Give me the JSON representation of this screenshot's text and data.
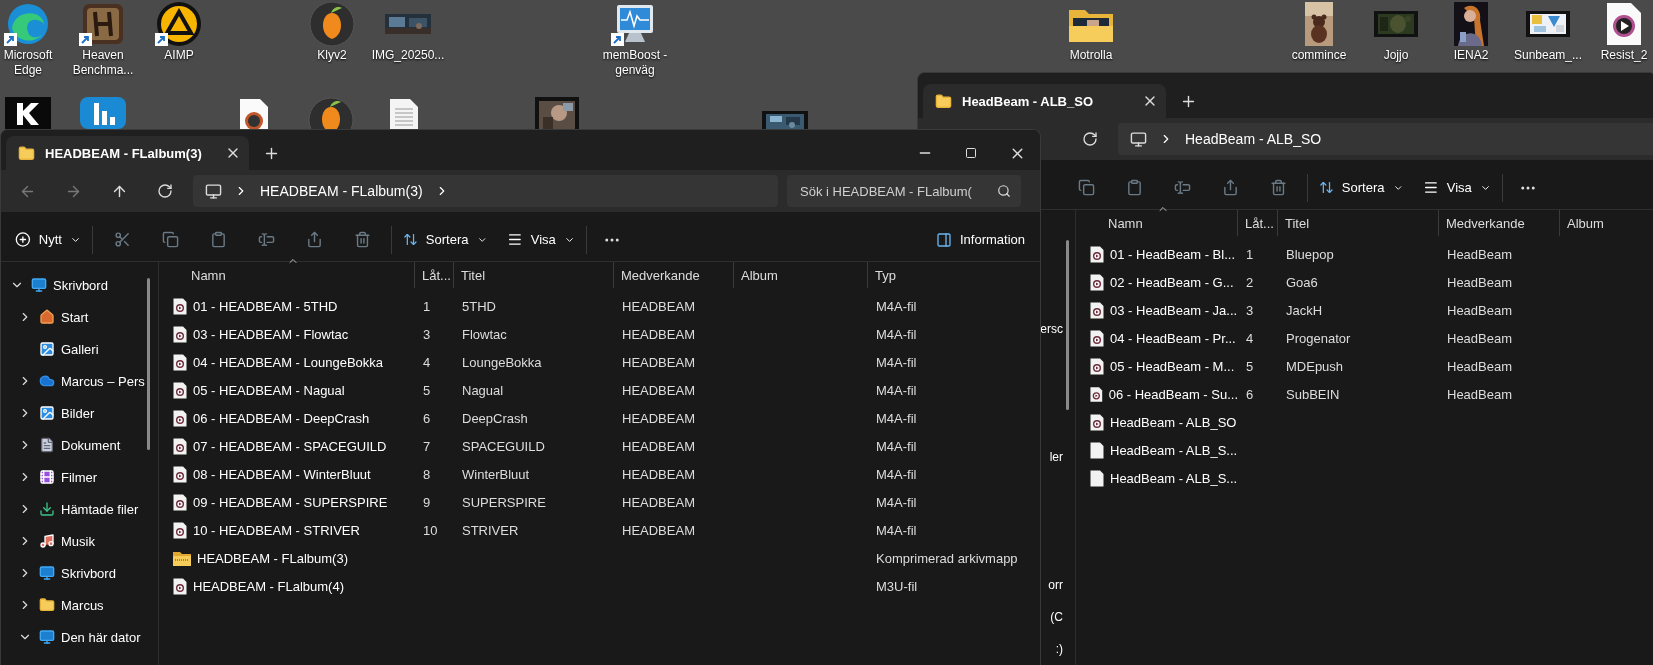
{
  "desktop": {
    "icons": [
      {
        "label": "Microsoft Edge",
        "kind": "edge",
        "shortcut": true
      },
      {
        "label": "Heaven Benchma...",
        "kind": "heaven",
        "shortcut": true
      },
      {
        "label": "AIMP",
        "kind": "aimp",
        "shortcut": true
      },
      {
        "label": "Klyv2",
        "kind": "fl",
        "shortcut": false
      },
      {
        "label": "IMG_20250...",
        "shortcut": false
      },
      {
        "label": "memBoost - genväg",
        "kind": "monitor",
        "shortcut": true
      },
      {
        "label": "Motrolla",
        "kind": "folder",
        "shortcut": false
      },
      {
        "label": "commince",
        "kind": "photo-tall",
        "shortcut": false
      },
      {
        "label": "Jojjo",
        "kind": "video",
        "shortcut": false
      },
      {
        "label": "IENA2",
        "kind": "portrait",
        "shortcut": false
      },
      {
        "label": "Sunbeam_...",
        "kind": "video-light",
        "shortcut": false
      },
      {
        "label": "Resist_2",
        "kind": "media",
        "shortcut": false
      }
    ]
  },
  "back_window": {
    "tabs": [
      {
        "title": "HeadBeam - ALB_SO",
        "selected": true
      }
    ],
    "address": "HeadBeam - ALB_SO",
    "toolbar": {
      "sort": "Sortera",
      "view": "Visa"
    },
    "sidebar_fragments": [
      "ersc",
      "ler",
      "orr",
      "(C",
      ":)"
    ],
    "columns": [
      {
        "label": "Namn",
        "sorted": true
      },
      {
        "label": "Låt...",
        "sorted": false
      },
      {
        "label": "Titel",
        "sorted": false
      },
      {
        "label": "Medverkande",
        "sorted": false
      },
      {
        "label": "Album",
        "sorted": false
      }
    ],
    "files": [
      {
        "name": "01 - HeadBeam - Bl...",
        "kind": "audio",
        "number": "1",
        "title": "Bluepop",
        "artist": "HeadBeam"
      },
      {
        "name": "02 - HeadBeam - G...",
        "kind": "audio",
        "number": "2",
        "title": "Goa6",
        "artist": "HeadBeam"
      },
      {
        "name": "03 - HeadBeam - Ja...",
        "kind": "audio",
        "number": "3",
        "title": "JackH",
        "artist": "HeadBeam"
      },
      {
        "name": "04 - HeadBeam - Pr...",
        "kind": "audio",
        "number": "4",
        "title": "Progenator",
        "artist": "HeadBeam"
      },
      {
        "name": "05 - HeadBeam - M...",
        "kind": "audio",
        "number": "5",
        "title": "MDEpush",
        "artist": "HeadBeam"
      },
      {
        "name": "06 - HeadBeam - Su...",
        "kind": "audio",
        "number": "6",
        "title": "SubBEIN",
        "artist": "HeadBeam"
      },
      {
        "name": "HeadBeam - ALB_SO",
        "kind": "audio"
      },
      {
        "name": "HeadBeam - ALB_S...",
        "kind": "blank"
      },
      {
        "name": "HeadBeam - ALB_S...",
        "kind": "blank"
      }
    ]
  },
  "front_window": {
    "tabs": [
      {
        "title": "HEADBEAM - FLalbum(3)",
        "selected": true
      }
    ],
    "address": "HEADBEAM - FLalbum(3)",
    "search": {
      "placeholder": "Sök i HEADBEAM - FLalbum("
    },
    "toolbar": {
      "new": "Nytt",
      "sort": "Sortera",
      "view": "Visa",
      "info": "Information"
    },
    "sidebar": {
      "items": [
        {
          "label": "Skrivbord",
          "kind": "desktop",
          "expandable": true,
          "expanded": true,
          "children": [
            {
              "label": "Start",
              "kind": "home",
              "expandable": true,
              "expanded": false
            },
            {
              "label": "Galleri",
              "kind": "gallery",
              "expandable": false
            },
            {
              "label": "Marcus – Pers",
              "kind": "cloud",
              "expandable": true,
              "expanded": false
            },
            {
              "label": "Bilder",
              "kind": "pictures",
              "expandable": true,
              "expanded": false
            },
            {
              "label": "Dokument",
              "kind": "documents",
              "expandable": true,
              "expanded": false
            },
            {
              "label": "Filmer",
              "kind": "videos",
              "expandable": true,
              "expanded": false
            },
            {
              "label": "Hämtade filer",
              "kind": "downloads",
              "expandable": true,
              "expanded": false
            },
            {
              "label": "Musik",
              "kind": "music",
              "expandable": true,
              "expanded": false
            },
            {
              "label": "Skrivbord",
              "kind": "desktop",
              "expandable": true,
              "expanded": false
            },
            {
              "label": "Marcus",
              "kind": "folder",
              "expandable": true,
              "expanded": false
            },
            {
              "label": "Den här dator",
              "kind": "pc",
              "expandable": true,
              "expanded": true
            }
          ]
        }
      ]
    },
    "columns": [
      {
        "label": "Namn",
        "sorted": true
      },
      {
        "label": "Låt...",
        "sorted": false
      },
      {
        "label": "Titel",
        "sorted": false
      },
      {
        "label": "Medverkande",
        "sorted": false
      },
      {
        "label": "Album",
        "sorted": false
      },
      {
        "label": "Typ",
        "sorted": false
      }
    ],
    "files": [
      {
        "name": "01 - HEADBEAM - 5THD",
        "kind": "audio",
        "number": "1",
        "title": "5THD",
        "artist": "HEADBEAM",
        "type": "M4A-fil"
      },
      {
        "name": "03 - HEADBEAM - Flowtac",
        "kind": "audio",
        "number": "3",
        "title": "Flowtac",
        "artist": "HEADBEAM",
        "type": "M4A-fil"
      },
      {
        "name": "04 - HEADBEAM - LoungeBokka",
        "kind": "audio",
        "number": "4",
        "title": "LoungeBokka",
        "artist": "HEADBEAM",
        "type": "M4A-fil"
      },
      {
        "name": "05 - HEADBEAM - Nagual",
        "kind": "audio",
        "number": "5",
        "title": "Nagual",
        "artist": "HEADBEAM",
        "type": "M4A-fil"
      },
      {
        "name": "06 - HEADBEAM - DeepCrash",
        "kind": "audio",
        "number": "6",
        "title": "DeepCrash",
        "artist": "HEADBEAM",
        "type": "M4A-fil"
      },
      {
        "name": "07 - HEADBEAM - SPACEGUILD",
        "kind": "audio",
        "number": "7",
        "title": "SPACEGUILD",
        "artist": "HEADBEAM",
        "type": "M4A-fil"
      },
      {
        "name": "08 - HEADBEAM - WinterBluut",
        "kind": "audio",
        "number": "8",
        "title": "WinterBluut",
        "artist": "HEADBEAM",
        "type": "M4A-fil"
      },
      {
        "name": "09 - HEADBEAM - SUPERSPIRE",
        "kind": "audio",
        "number": "9",
        "title": "SUPERSPIRE",
        "artist": "HEADBEAM",
        "type": "M4A-fil"
      },
      {
        "name": "10 - HEADBEAM - STRIVER",
        "kind": "audio",
        "number": "10",
        "title": "STRIVER",
        "artist": "HEADBEAM",
        "type": "M4A-fil"
      },
      {
        "name": "HEADBEAM - FLalbum(3)",
        "kind": "zip",
        "type": "Komprimerad arkivmapp"
      },
      {
        "name": "HEADBEAM - FLalbum(4)",
        "kind": "audio",
        "type": "M3U-fil"
      }
    ]
  }
}
